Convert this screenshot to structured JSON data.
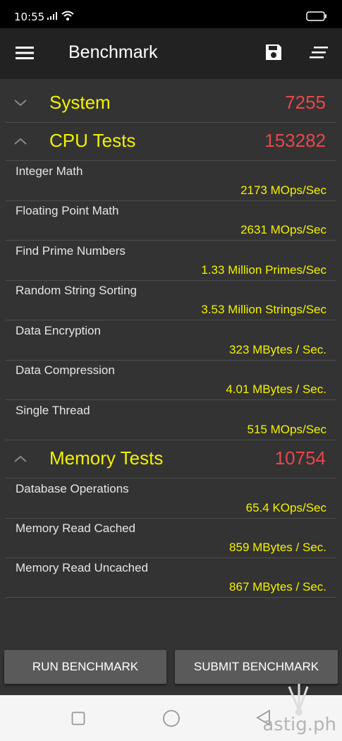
{
  "status_bar": {
    "time": "10:55"
  },
  "app_bar": {
    "title": "Benchmark"
  },
  "sections": {
    "system": {
      "title": "System",
      "score": "7255"
    },
    "cpu": {
      "title": "CPU Tests",
      "score": "153282"
    },
    "memory": {
      "title": "Memory Tests",
      "score": "10754"
    }
  },
  "cpu_results": [
    {
      "label": "Integer Math",
      "value": "2173 MOps/Sec"
    },
    {
      "label": "Floating Point Math",
      "value": "2631 MOps/Sec"
    },
    {
      "label": "Find Prime Numbers",
      "value": "1.33 Million Primes/Sec"
    },
    {
      "label": "Random String Sorting",
      "value": "3.53 Million Strings/Sec"
    },
    {
      "label": "Data Encryption",
      "value": "323 MBytes / Sec."
    },
    {
      "label": "Data Compression",
      "value": "4.01 MBytes / Sec."
    },
    {
      "label": "Single Thread",
      "value": "515 MOps/Sec"
    }
  ],
  "memory_results": [
    {
      "label": "Database Operations",
      "value": "65.4 KOps/Sec"
    },
    {
      "label": "Memory Read Cached",
      "value": "859 MBytes / Sec."
    },
    {
      "label": "Memory Read Uncached",
      "value": "867 MBytes / Sec."
    }
  ],
  "buttons": {
    "run": "RUN BENCHMARK",
    "submit": "SUBMIT BENCHMARK"
  },
  "watermark": "astig.ph",
  "colors": {
    "section_title": "#f2f200",
    "score": "#e8474a",
    "value": "#f2f200",
    "background": "#333333"
  }
}
